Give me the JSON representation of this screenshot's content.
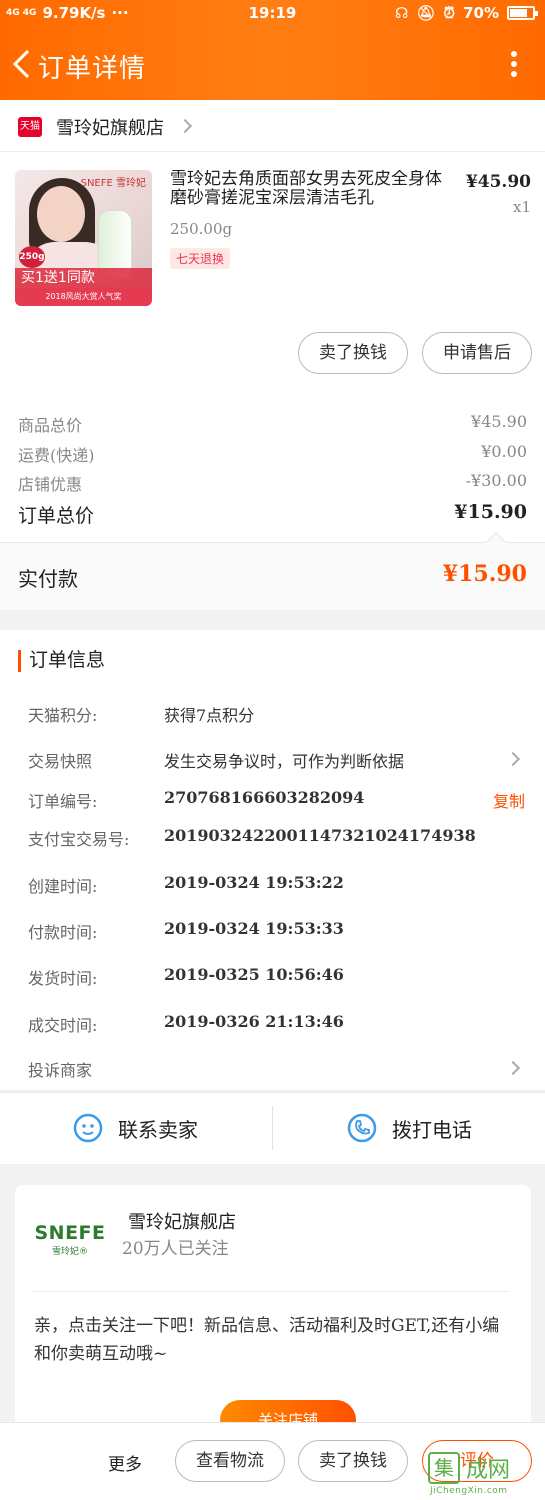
{
  "status_bar": {
    "network": "4G 4G",
    "speed": "9.79K/s",
    "dots": "···",
    "time": "19:19",
    "battery": "70%"
  },
  "navbar": {
    "title": "订单详情"
  },
  "shop": {
    "platform_badge": "天猫",
    "name": "雪玲妃旗舰店"
  },
  "product": {
    "image_brand": "SNEFE 雪玲妃",
    "image_gram": "250g",
    "image_promo": "买1送1同款",
    "image_promo2": "2018风尚大赏人气奖",
    "title": "雪玲妃去角质面部女男去死皮全身体磨砂膏搓泥宝深层清洁毛孔",
    "spec": "250.00g",
    "tag": "七天退换",
    "price": "¥45.90",
    "qty": "x1",
    "btn_refund": "卖了换钱",
    "btn_after_sale": "申请售后"
  },
  "summary": {
    "items": [
      {
        "label": "商品总价",
        "value": "¥45.90"
      },
      {
        "label": "运费(快递)",
        "value": "¥0.00"
      },
      {
        "label": "店铺优惠",
        "value": "-¥30.00"
      }
    ],
    "order_total_label": "订单总价",
    "order_total_value": "¥15.90",
    "paid_label": "实付款",
    "paid_value": "¥15.90"
  },
  "order_info": {
    "heading": "订单信息",
    "rows": [
      {
        "label": "天猫积分:",
        "value": "获得7点积分"
      },
      {
        "label": "交易快照",
        "value": "发生交易争议时，可作为判断依据"
      },
      {
        "label": "订单编号:",
        "value": "270768166603282094"
      },
      {
        "label": "支付宝交易号:",
        "value": "2019032422001147321024174938"
      },
      {
        "label": "创建时间:",
        "value": "2019-0324 19:53:22"
      },
      {
        "label": "付款时间:",
        "value": "2019-0324 19:53:33"
      },
      {
        "label": "发货时间:",
        "value": "2019-0325 10:56:46"
      },
      {
        "label": "成交时间:",
        "value": "2019-0326 21:13:46"
      },
      {
        "label": "投诉商家",
        "value": ""
      }
    ],
    "copy_label": "复制"
  },
  "contact": {
    "seller": "联系卖家",
    "call": "拨打电话"
  },
  "follow": {
    "logo_text": "SNEFE",
    "logo_sub": "雪玲妃®",
    "shop_name": "雪玲妃旗舰店",
    "followers": "20万人已关注",
    "message": "亲，点击关注一下吧！新品信息、活动福利及时GET,还有小编和你卖萌互动哦~",
    "follow_btn": "关注店铺"
  },
  "bottom": {
    "more": "更多",
    "logistics": "查看物流",
    "resell": "卖了换钱",
    "rate": "评价"
  },
  "watermark": {
    "box": "集",
    "cn": "成网",
    "en": "JiChengXin.com"
  },
  "colors": {
    "accent": "#ff5000",
    "header": "#ff7a10",
    "link_blue": "#3e9be8"
  }
}
